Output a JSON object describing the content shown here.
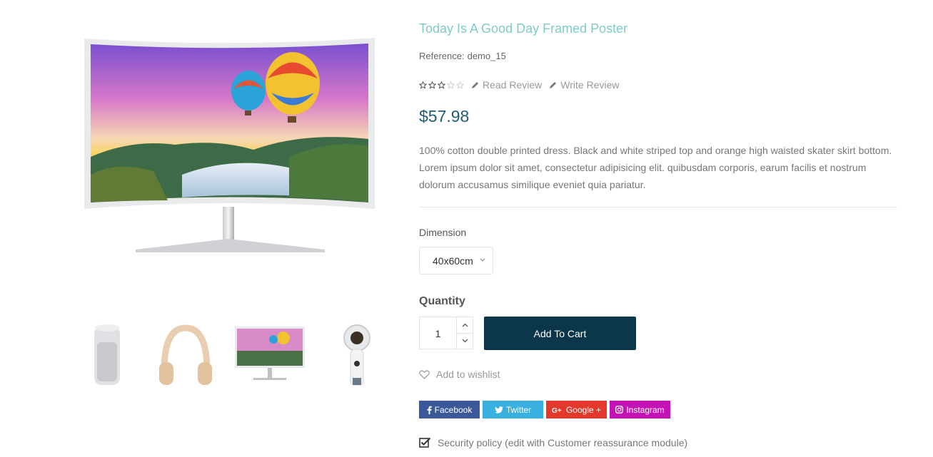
{
  "product": {
    "title": "Today Is A Good Day Framed Poster",
    "reference_label": "Reference:",
    "reference_value": "demo_15",
    "rating": 3,
    "rating_max": 5,
    "read_review": "Read Review",
    "write_review": "Write Review",
    "price": "$57.98",
    "description": "100% cotton double printed dress. Black and white striped top and orange high waisted skater skirt bottom. Lorem ipsum dolor sit amet, consectetur adipisicing elit. quibusdam corporis, earum facilis et nostrum dolorum accusamus similique eveniet quia pariatur."
  },
  "gallery": {
    "main_image": "curved-monitor-balloons",
    "thumbnails": [
      "speaker",
      "headphones",
      "monitor",
      "360-camera"
    ]
  },
  "options": {
    "dimension_label": "Dimension",
    "dimension_selected": "40x60cm"
  },
  "cart": {
    "quantity_label": "Quantity",
    "quantity_value": "1",
    "add_to_cart": "Add To Cart",
    "wishlist": "Add to wishlist"
  },
  "social": {
    "facebook": "Facebook",
    "twitter": "Twitter",
    "google": "Google +",
    "instagram": "Instagram"
  },
  "reassurance": {
    "text": "Security policy (edit with Customer reassurance module)"
  },
  "colors": {
    "title": "#7ecbc9",
    "price": "#1f5e78",
    "add_to_cart_bg": "#0c3649",
    "facebook": "#3b5998",
    "twitter": "#3ab0de",
    "google": "#e3382b",
    "instagram": "#c413b5"
  }
}
